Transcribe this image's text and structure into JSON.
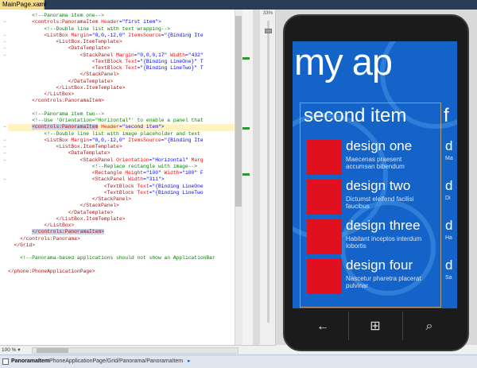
{
  "tab": {
    "label": "MainPage.xaml",
    "close": "x"
  },
  "editor": {
    "lines": [
      {
        "fold": "",
        "hl": false,
        "parts": [
          {
            "t": "        ",
            "c": ""
          },
          {
            "t": "<!--Panorama item one-->",
            "c": "c-cm"
          }
        ]
      },
      {
        "fold": "−",
        "hl": false,
        "parts": [
          {
            "t": "        ",
            "c": ""
          },
          {
            "t": "<controls:PanoramaItem ",
            "c": "c-tg"
          },
          {
            "t": "Header",
            "c": "c-at"
          },
          {
            "t": "=\"first item\">",
            "c": "c-vl"
          }
        ]
      },
      {
        "fold": "",
        "hl": false,
        "parts": [
          {
            "t": "            ",
            "c": ""
          },
          {
            "t": "<!--Double line list with text wrapping-->",
            "c": "c-cm"
          }
        ]
      },
      {
        "fold": "−",
        "hl": false,
        "parts": [
          {
            "t": "            ",
            "c": ""
          },
          {
            "t": "<ListBox ",
            "c": "c-tg"
          },
          {
            "t": "Margin",
            "c": "c-at"
          },
          {
            "t": "=\"0,0,-12,0\" ",
            "c": "c-vl"
          },
          {
            "t": "ItemsSource",
            "c": "c-at"
          },
          {
            "t": "=\"{Binding Ite",
            "c": "c-vl"
          }
        ]
      },
      {
        "fold": "−",
        "hl": false,
        "parts": [
          {
            "t": "                ",
            "c": ""
          },
          {
            "t": "<ListBox.ItemTemplate>",
            "c": "c-tg"
          }
        ]
      },
      {
        "fold": "−",
        "hl": false,
        "parts": [
          {
            "t": "                    ",
            "c": ""
          },
          {
            "t": "<DataTemplate>",
            "c": "c-tg"
          }
        ]
      },
      {
        "fold": "−",
        "hl": false,
        "parts": [
          {
            "t": "                        ",
            "c": ""
          },
          {
            "t": "<StackPanel ",
            "c": "c-tg"
          },
          {
            "t": "Margin",
            "c": "c-at"
          },
          {
            "t": "=\"0,0,0,17\" ",
            "c": "c-vl"
          },
          {
            "t": "Width",
            "c": "c-at"
          },
          {
            "t": "=\"432\"",
            "c": "c-vl"
          }
        ]
      },
      {
        "fold": "",
        "hl": false,
        "parts": [
          {
            "t": "                            ",
            "c": ""
          },
          {
            "t": "<TextBlock ",
            "c": "c-tg"
          },
          {
            "t": "Text",
            "c": "c-at"
          },
          {
            "t": "=\"{Binding LineOne}\" T",
            "c": "c-vl"
          }
        ]
      },
      {
        "fold": "",
        "hl": false,
        "parts": [
          {
            "t": "                            ",
            "c": ""
          },
          {
            "t": "<TextBlock ",
            "c": "c-tg"
          },
          {
            "t": "Text",
            "c": "c-at"
          },
          {
            "t": "=\"{Binding LineTwo}\" T",
            "c": "c-vl"
          }
        ]
      },
      {
        "fold": "",
        "hl": false,
        "parts": [
          {
            "t": "                        ",
            "c": ""
          },
          {
            "t": "</StackPanel>",
            "c": "c-tg"
          }
        ]
      },
      {
        "fold": "",
        "hl": false,
        "parts": [
          {
            "t": "                    ",
            "c": ""
          },
          {
            "t": "</DataTemplate>",
            "c": "c-tg"
          }
        ]
      },
      {
        "fold": "",
        "hl": false,
        "parts": [
          {
            "t": "                ",
            "c": ""
          },
          {
            "t": "</ListBox.ItemTemplate>",
            "c": "c-tg"
          }
        ]
      },
      {
        "fold": "",
        "hl": false,
        "parts": [
          {
            "t": "            ",
            "c": ""
          },
          {
            "t": "</ListBox>",
            "c": "c-tg"
          }
        ]
      },
      {
        "fold": "",
        "hl": false,
        "parts": [
          {
            "t": "        ",
            "c": ""
          },
          {
            "t": "</controls:PanoramaItem>",
            "c": "c-tg"
          }
        ]
      },
      {
        "fold": "",
        "hl": false,
        "parts": [
          {
            "t": "",
            "c": ""
          }
        ]
      },
      {
        "fold": "",
        "hl": false,
        "parts": [
          {
            "t": "        ",
            "c": ""
          },
          {
            "t": "<!--Panorama item two-->",
            "c": "c-cm"
          }
        ]
      },
      {
        "fold": "",
        "hl": false,
        "parts": [
          {
            "t": "        ",
            "c": ""
          },
          {
            "t": "<!--Use 'Orientation=\"Horizontal\"' to enable a panel that",
            "c": "c-cm"
          }
        ]
      },
      {
        "fold": "−",
        "hl": true,
        "parts": [
          {
            "t": "        ",
            "c": ""
          },
          {
            "t": "<controls:PanoramaItem",
            "c": "c-tg sel"
          },
          {
            "t": " ",
            "c": ""
          },
          {
            "t": "Header",
            "c": "c-at"
          },
          {
            "t": "=\"second item\">",
            "c": "c-vl"
          }
        ]
      },
      {
        "fold": "",
        "hl": false,
        "parts": [
          {
            "t": "            ",
            "c": ""
          },
          {
            "t": "<!--Double line list with image placeholder and text",
            "c": "c-cm"
          }
        ]
      },
      {
        "fold": "−",
        "hl": false,
        "parts": [
          {
            "t": "            ",
            "c": ""
          },
          {
            "t": "<ListBox ",
            "c": "c-tg"
          },
          {
            "t": "Margin",
            "c": "c-at"
          },
          {
            "t": "=\"0,0,-12,0\" ",
            "c": "c-vl"
          },
          {
            "t": "ItemsSource",
            "c": "c-at"
          },
          {
            "t": "=\"{Binding Ite",
            "c": "c-vl"
          }
        ]
      },
      {
        "fold": "−",
        "hl": false,
        "parts": [
          {
            "t": "                ",
            "c": ""
          },
          {
            "t": "<ListBox.ItemTemplate>",
            "c": "c-tg"
          }
        ]
      },
      {
        "fold": "−",
        "hl": false,
        "parts": [
          {
            "t": "                    ",
            "c": ""
          },
          {
            "t": "<DataTemplate>",
            "c": "c-tg"
          }
        ]
      },
      {
        "fold": "−",
        "hl": false,
        "parts": [
          {
            "t": "                        ",
            "c": ""
          },
          {
            "t": "<StackPanel ",
            "c": "c-tg"
          },
          {
            "t": "Orientation",
            "c": "c-at"
          },
          {
            "t": "=\"Horizontal\" ",
            "c": "c-vl"
          },
          {
            "t": "Marg",
            "c": "c-at"
          }
        ]
      },
      {
        "fold": "",
        "hl": false,
        "parts": [
          {
            "t": "                            ",
            "c": ""
          },
          {
            "t": "<!--Replace rectangle with image-->",
            "c": "c-cm"
          }
        ]
      },
      {
        "fold": "",
        "hl": false,
        "parts": [
          {
            "t": "                            ",
            "c": ""
          },
          {
            "t": "<Rectangle ",
            "c": "c-tg"
          },
          {
            "t": "Height",
            "c": "c-at"
          },
          {
            "t": "=\"100\" ",
            "c": "c-vl"
          },
          {
            "t": "Width",
            "c": "c-at"
          },
          {
            "t": "=\"100\" F",
            "c": "c-vl"
          }
        ]
      },
      {
        "fold": "−",
        "hl": false,
        "parts": [
          {
            "t": "                            ",
            "c": ""
          },
          {
            "t": "<StackPanel ",
            "c": "c-tg"
          },
          {
            "t": "Width",
            "c": "c-at"
          },
          {
            "t": "=\"311\">",
            "c": "c-vl"
          }
        ]
      },
      {
        "fold": "",
        "hl": false,
        "parts": [
          {
            "t": "                                ",
            "c": ""
          },
          {
            "t": "<TextBlock ",
            "c": "c-tg"
          },
          {
            "t": "Text",
            "c": "c-at"
          },
          {
            "t": "=\"{Binding LineOne",
            "c": "c-vl"
          }
        ]
      },
      {
        "fold": "",
        "hl": false,
        "parts": [
          {
            "t": "                                ",
            "c": ""
          },
          {
            "t": "<TextBlock ",
            "c": "c-tg"
          },
          {
            "t": "Text",
            "c": "c-at"
          },
          {
            "t": "=\"{Binding LineTwo",
            "c": "c-vl"
          }
        ]
      },
      {
        "fold": "",
        "hl": false,
        "parts": [
          {
            "t": "                            ",
            "c": ""
          },
          {
            "t": "</StackPanel>",
            "c": "c-tg"
          }
        ]
      },
      {
        "fold": "",
        "hl": false,
        "parts": [
          {
            "t": "                        ",
            "c": ""
          },
          {
            "t": "</StackPanel>",
            "c": "c-tg"
          }
        ]
      },
      {
        "fold": "",
        "hl": false,
        "parts": [
          {
            "t": "                    ",
            "c": ""
          },
          {
            "t": "</DataTemplate>",
            "c": "c-tg"
          }
        ]
      },
      {
        "fold": "",
        "hl": false,
        "parts": [
          {
            "t": "                ",
            "c": ""
          },
          {
            "t": "</ListBox.ItemTemplate>",
            "c": "c-tg"
          }
        ]
      },
      {
        "fold": "",
        "hl": false,
        "parts": [
          {
            "t": "            ",
            "c": ""
          },
          {
            "t": "</ListBox>",
            "c": "c-tg"
          }
        ]
      },
      {
        "fold": "",
        "hl": false,
        "parts": [
          {
            "t": "        ",
            "c": ""
          },
          {
            "t": "</controls:PanoramaItem>",
            "c": "c-tg sel"
          }
        ]
      },
      {
        "fold": "",
        "hl": false,
        "parts": [
          {
            "t": "    ",
            "c": ""
          },
          {
            "t": "</controls:Panorama>",
            "c": "c-tg"
          }
        ]
      },
      {
        "fold": "",
        "hl": false,
        "parts": [
          {
            "t": "  ",
            "c": ""
          },
          {
            "t": "</Grid>",
            "c": "c-tg"
          }
        ]
      },
      {
        "fold": "",
        "hl": false,
        "parts": [
          {
            "t": "",
            "c": ""
          }
        ]
      },
      {
        "fold": "",
        "hl": false,
        "parts": [
          {
            "t": "    ",
            "c": ""
          },
          {
            "t": "<!--Panorama-based applications should not show an ApplicationBar",
            "c": "c-cm"
          }
        ]
      },
      {
        "fold": "",
        "hl": false,
        "parts": [
          {
            "t": "",
            "c": ""
          }
        ]
      },
      {
        "fold": "",
        "hl": false,
        "parts": [
          {
            "t": "",
            "c": ""
          },
          {
            "t": "</phone:PhoneApplicationPage>",
            "c": "c-tg"
          }
        ]
      }
    ]
  },
  "zoom": {
    "slider_label": "33%",
    "bottom_value": "100 %",
    "bottom_dropdown": "▾"
  },
  "phone": {
    "panorama_title": "my ap",
    "header_current": "second item",
    "header_next": "f",
    "items": [
      {
        "line_one": "design one",
        "line_two": "Maecenas praesent accumsan bibendum"
      },
      {
        "line_one": "design two",
        "line_two": "Dictumst eleifend facilisi faucibus"
      },
      {
        "line_one": "design three",
        "line_two": "Habitant inceptos interdum lobortis"
      },
      {
        "line_one": "design four",
        "line_two": "Nascetur pharetra placerat pulvinar"
      }
    ],
    "peek_items": [
      {
        "line_one": "d",
        "line_two": "Ma"
      },
      {
        "line_one": "d",
        "line_two": "Di"
      },
      {
        "line_one": "d",
        "line_two": "Ha"
      },
      {
        "line_one": "d",
        "line_two": "Sa"
      }
    ],
    "buttons": {
      "back": "←",
      "start": "⊞",
      "search": "⌕"
    }
  },
  "statusbar": {
    "bold": "PanoramaItem",
    "path": "PhoneApplicationPage/Grid/Panorama/PanoramaItem",
    "arrow": "▸"
  },
  "colors": {
    "accent": "#1363c9",
    "tile": "#e0101e",
    "tab": "#f5dc8a"
  }
}
